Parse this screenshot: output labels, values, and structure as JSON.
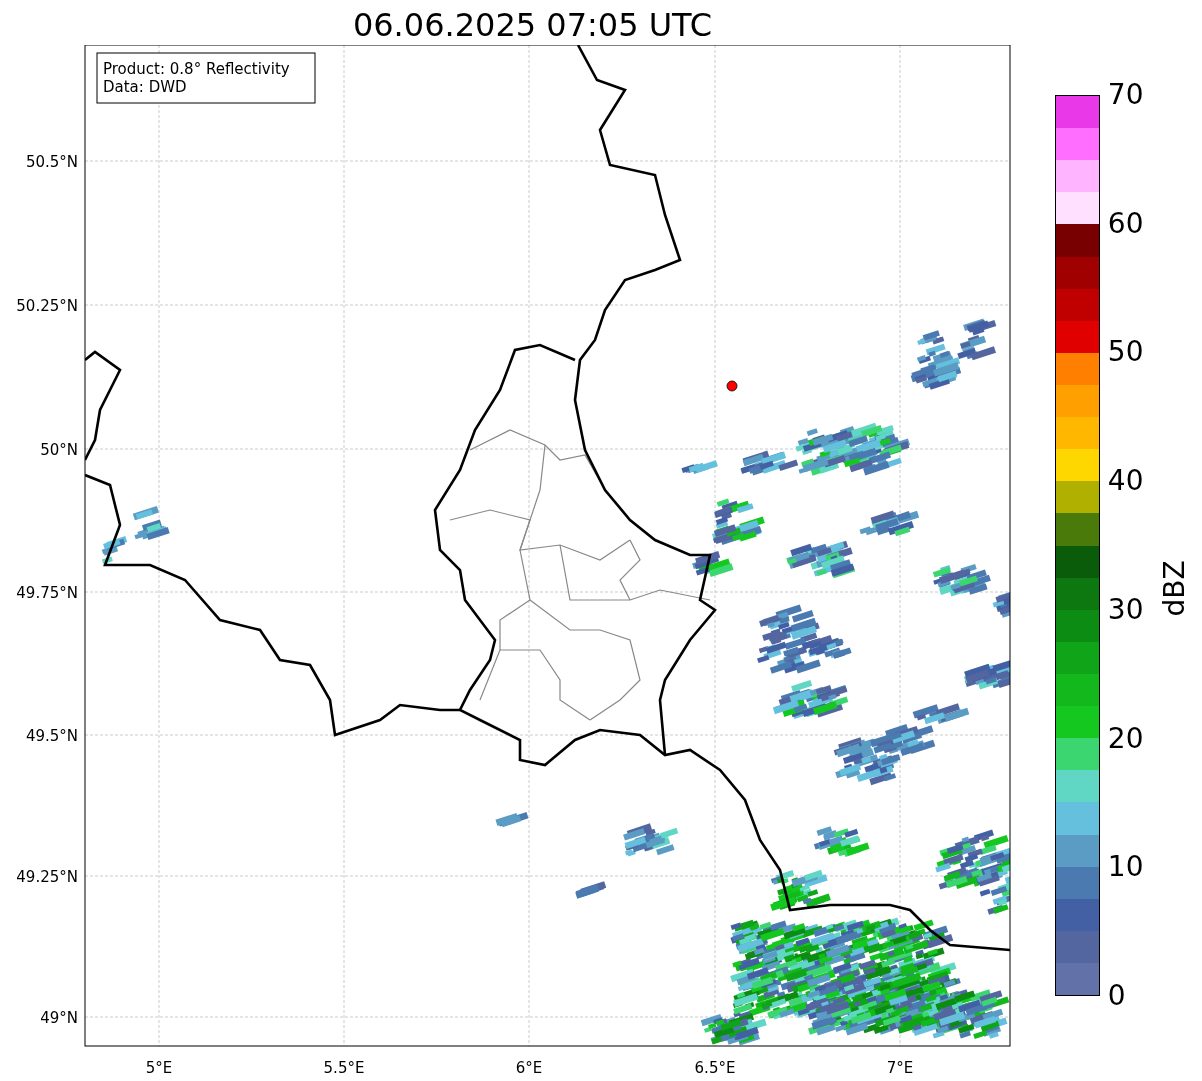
{
  "title": "06.06.2025 07:05 UTC",
  "info_box": [
    "Product: 0.8° Reflectivity",
    "Data: DWD"
  ],
  "map": {
    "y_ticks": [
      "50.5°N",
      "50.25°N",
      "50°N",
      "49.75°N",
      "49.5°N",
      "49.25°N",
      "49°N"
    ],
    "x_ticks": [
      "5°E",
      "5.5°E",
      "6°E",
      "6.5°E",
      "7°E"
    ]
  },
  "colorbar": {
    "label": "dBZ",
    "ticks": [
      "70",
      "60",
      "50",
      "40",
      "30",
      "20",
      "10",
      "0"
    ],
    "bands": [
      {
        "color": "#e838e8"
      },
      {
        "color": "#ff6eff"
      },
      {
        "color": "#ffb4ff"
      },
      {
        "color": "#ffe0ff"
      },
      {
        "color": "#780000"
      },
      {
        "color": "#a00000"
      },
      {
        "color": "#c00000"
      },
      {
        "color": "#e00000"
      },
      {
        "color": "#ff7f00"
      },
      {
        "color": "#ff9f00"
      },
      {
        "color": "#ffb700"
      },
      {
        "color": "#ffd700"
      },
      {
        "color": "#b0b000"
      },
      {
        "color": "#4a7a0a"
      },
      {
        "color": "#0a5c0a"
      },
      {
        "color": "#0e7810"
      },
      {
        "color": "#0c8c12"
      },
      {
        "color": "#10a418"
      },
      {
        "color": "#12b81c"
      },
      {
        "color": "#14c820"
      },
      {
        "color": "#3cd670"
      },
      {
        "color": "#60d6c4"
      },
      {
        "color": "#64c0dc"
      },
      {
        "color": "#5a9cc4"
      },
      {
        "color": "#4a7ab0"
      },
      {
        "color": "#4460a4"
      },
      {
        "color": "#5466a0"
      },
      {
        "color": "#6272a8"
      }
    ]
  }
}
